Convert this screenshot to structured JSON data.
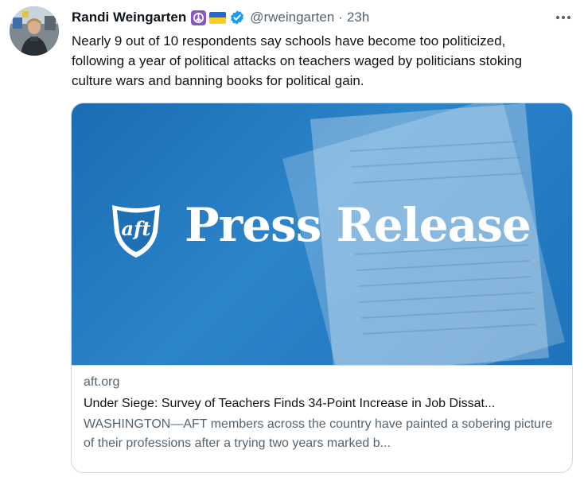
{
  "tweet": {
    "author_name": "Randi Weingarten",
    "author_emojis": [
      "peace-symbol",
      "ukraine-flag"
    ],
    "verified": true,
    "handle": "@rweingarten",
    "separator": "·",
    "timestamp": "23h",
    "more_icon": "more-horizontal-icon",
    "text": "Nearly 9 out of 10  respondents say schools have become too politicized,\nfollowing a year of political attacks on teachers waged by politicians stoking\nculture wars and banning books for political gain."
  },
  "card": {
    "image_logo_text": "aft",
    "image_title": "Press Release",
    "domain": "aft.org",
    "title": "Under Siege: Survey of Teachers Finds 34-Point Increase in Job Dissat...",
    "description": "WASHINGTON—AFT members across the country have painted a sobering picture of their professions after a trying two years marked b..."
  },
  "colors": {
    "verified_blue": "#1d9bf0",
    "card_blue": "#1b6cb3",
    "secondary_text": "#536471",
    "primary_text": "#0f1419",
    "border": "#cfd9de"
  }
}
